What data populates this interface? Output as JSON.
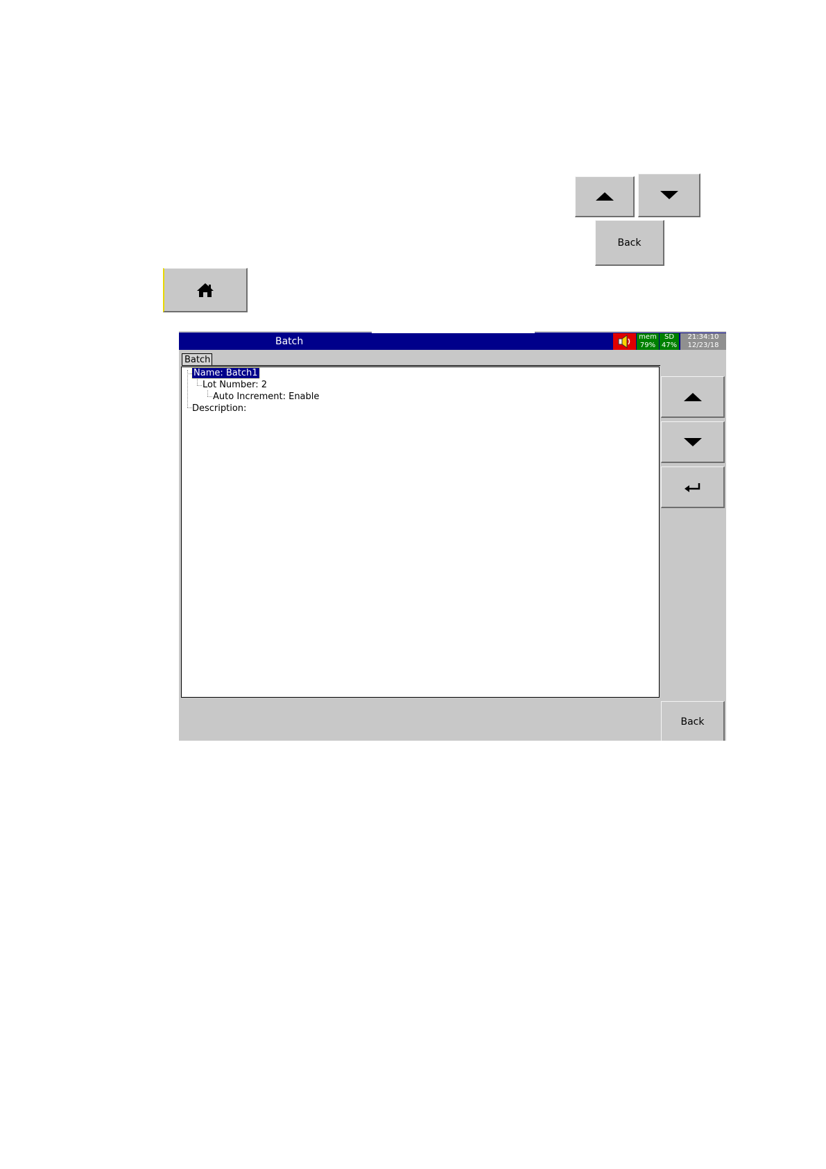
{
  "top_buttons": {
    "up_icon": "triangle-up-icon",
    "down_icon": "triangle-down-icon",
    "back_label": "Back",
    "home_icon": "house-icon"
  },
  "screen": {
    "title": "Batch",
    "status": {
      "mem_label": "mem",
      "mem_value": "79%",
      "sd_label": "SD",
      "sd_value": "47%",
      "time": "21:34:10",
      "date": "12/23/18"
    },
    "tab_label": "Batch",
    "tree": {
      "name": "Name: Batch1",
      "lot_number": "Lot Number: 2",
      "auto_increment": "Auto Increment: Enable",
      "description": "Description:"
    },
    "side_buttons": [
      "triangle-up-icon",
      "triangle-down-icon",
      "enter-arrow-icon"
    ],
    "back_label": "Back"
  },
  "colors": {
    "title_bar": "#00008b",
    "status_green": "#008000",
    "speaker_red": "#e00000",
    "button_grey": "#c8c8c8"
  }
}
